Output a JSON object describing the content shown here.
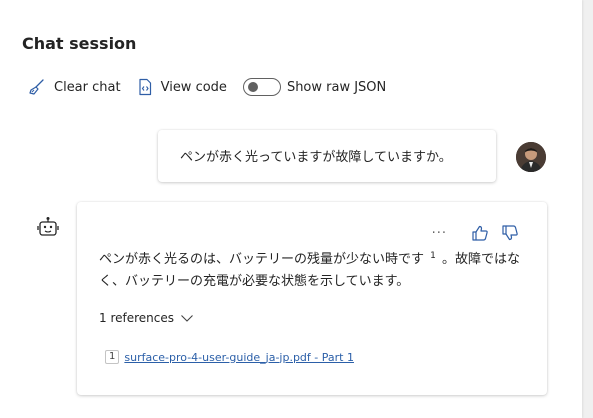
{
  "header": {
    "title": "Chat session"
  },
  "toolbar": {
    "clear_label": "Clear chat",
    "view_code_label": "View code",
    "raw_json_label": "Show raw JSON",
    "raw_json_enabled": false
  },
  "messages": {
    "user": {
      "text": "ペンが赤く光っていますが故障していますか。"
    },
    "bot": {
      "more_label": "···",
      "text_part1": "ペンが赤く光るのは、バッテリーの残量が少ない時です",
      "citation": "1",
      "text_part2": "。故障ではなく、バッテリーの充電が必要な状態を示しています。",
      "references_label": "1 references",
      "reference": {
        "number": "1",
        "title": "surface-pro-4-user-guide_ja-jp.pdf - Part 1"
      }
    }
  },
  "colors": {
    "link": "#2b5fa8",
    "accent_icon": "#2f5ea6",
    "text": "#242424"
  }
}
